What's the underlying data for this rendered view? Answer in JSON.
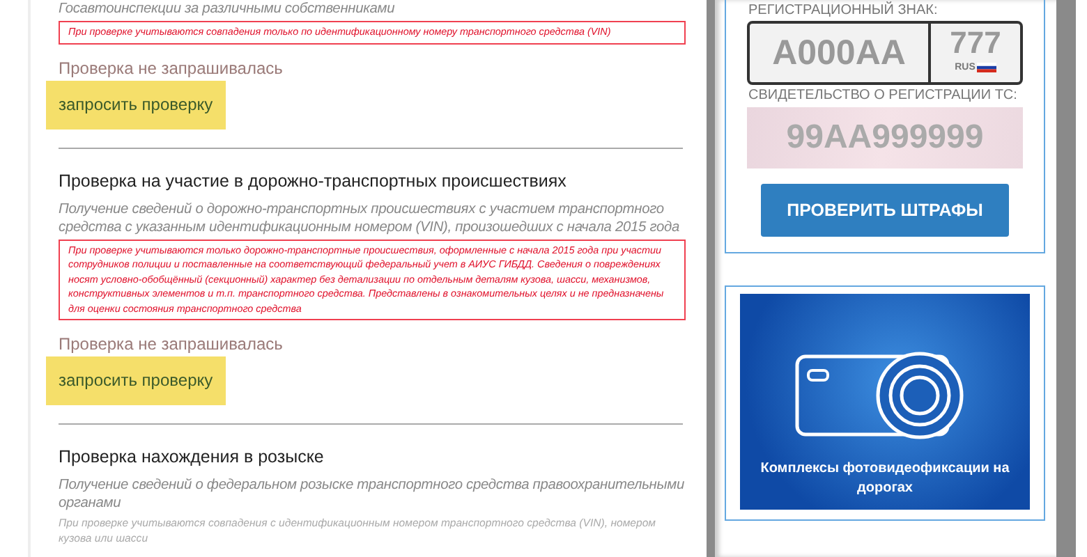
{
  "main": {
    "sections": [
      {
        "description": "Госавтоинспекции за различными собственниками",
        "note": {
          "kind": "warning",
          "text": "При проверке учитываются совпадения только по идентификационному номеру транспортного средства (VIN)"
        },
        "status": "Проверка не запрашивалась",
        "button": "запросить проверку"
      },
      {
        "heading": "Проверка на участие в дорожно-транспортных происшествиях",
        "description": "Получение сведений о дорожно-транспортных происшествиях с участием транспортного средства с указанным идентификационным номером (VIN), произошедших с начала 2015 года",
        "note": {
          "kind": "warning",
          "text": "При проверке учитываются только дорожно-транспортные происшествия, оформленные с начала 2015 года при участии сотрудников полиции и поставленные на соответствующий федеральный учет в АИУС ГИБДД. Сведения о повреждениях носят условно-обобщённый (секционный) характер без детализации по отдельным деталям кузова, шасси, механизмов, конструктивных элементов и т.п. транспортного средства. Представлены в ознакомительных целях и не предназначены для оценки состояния транспортного средства"
        },
        "status": "Проверка не запрашивалась",
        "button": "запросить проверку"
      },
      {
        "heading": "Проверка нахождения в розыске",
        "description": "Получение сведений о федеральном розыске транспортного средства правоохранительными органами",
        "note": {
          "kind": "plain",
          "text": "При проверке учитываются совпадения с идентификационным номером транспортного средства (VIN), номером кузова или шасси"
        }
      }
    ]
  },
  "sidebar": {
    "plate_label": "РЕГИСТРАЦИОННЫЙ ЗНАК:",
    "plate_number": "А000АА",
    "plate_region": "777",
    "plate_country": "RUS",
    "certificate_label": "СВИДЕТЕЛЬСТВО О РЕГИСТРАЦИИ ТС:",
    "certificate_number": "99АА999999",
    "button": "ПРОВЕРИТЬ ШТРАФЫ",
    "banner_caption": "Комплексы фотовидеофиксации на дорогах"
  }
}
